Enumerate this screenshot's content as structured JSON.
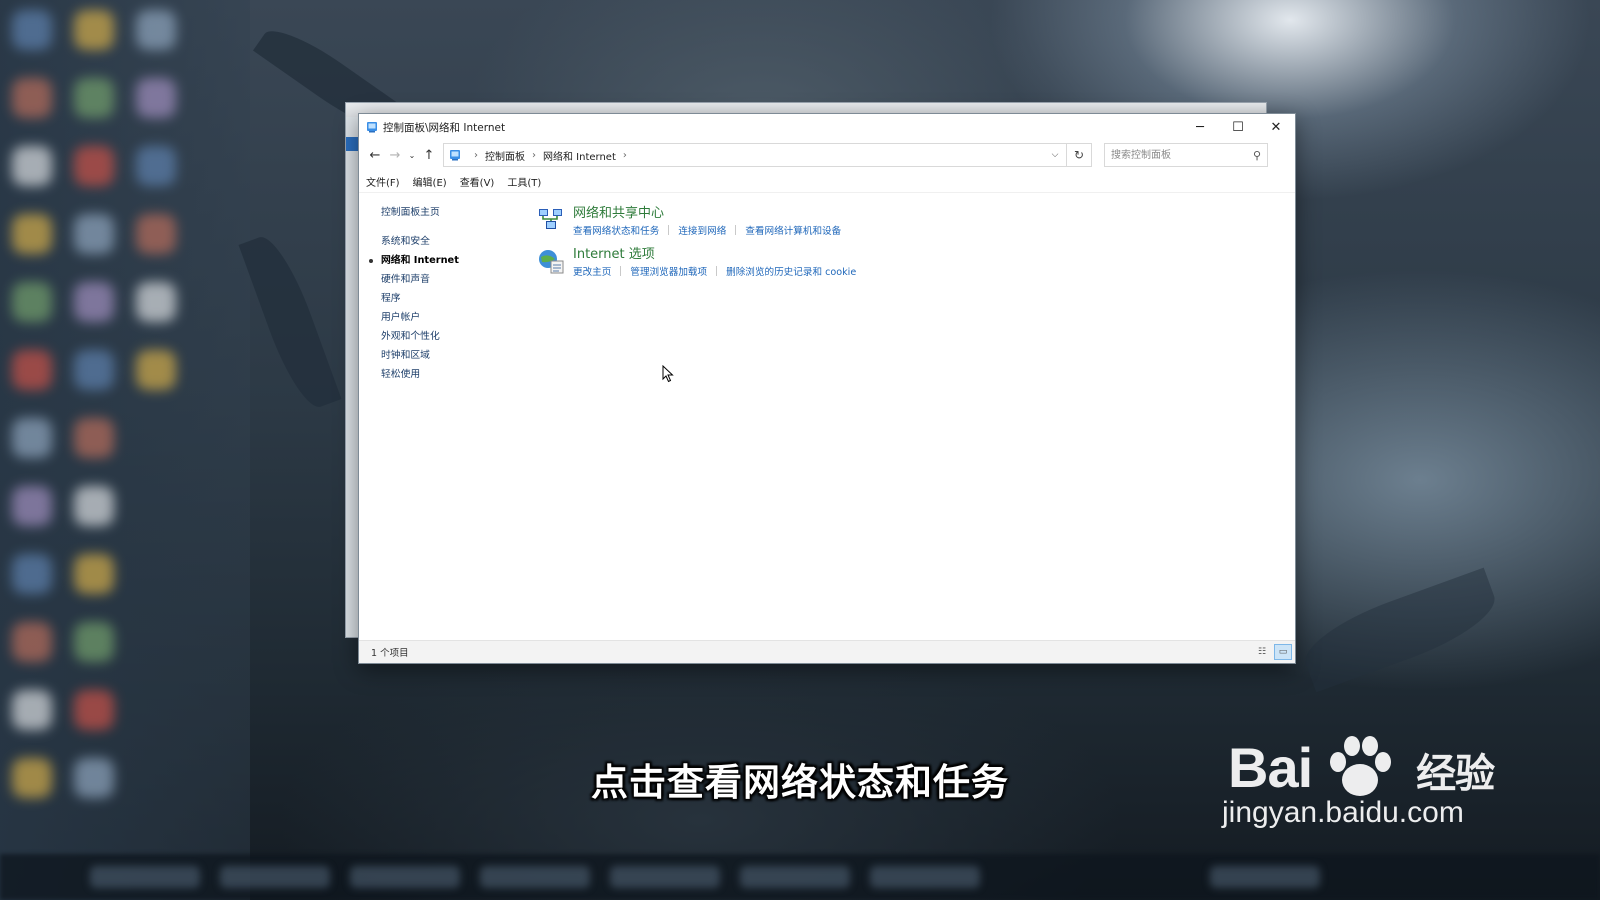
{
  "window": {
    "title": "控制面板\\网络和 Internet",
    "minimize": "─",
    "maximize": "☐",
    "close": "✕"
  },
  "address": {
    "crumbs": [
      "控制面板",
      "网络和 Internet"
    ],
    "search_placeholder": "搜索控制面板"
  },
  "menu": [
    "文件(F)",
    "编辑(E)",
    "查看(V)",
    "工具(T)"
  ],
  "sidebar": {
    "home": "控制面板主页",
    "items": [
      {
        "label": "系统和安全",
        "active": false
      },
      {
        "label": "网络和 Internet",
        "active": true
      },
      {
        "label": "硬件和声音",
        "active": false
      },
      {
        "label": "程序",
        "active": false
      },
      {
        "label": "用户帐户",
        "active": false
      },
      {
        "label": "外观和个性化",
        "active": false
      },
      {
        "label": "时钟和区域",
        "active": false
      },
      {
        "label": "轻松使用",
        "active": false
      }
    ]
  },
  "categories": [
    {
      "icon": "network-sharing-center-icon",
      "title": "网络和共享中心",
      "links": [
        "查看网络状态和任务",
        "连接到网络",
        "查看网络计算机和设备"
      ]
    },
    {
      "icon": "internet-options-icon",
      "title": "Internet 选项",
      "links": [
        "更改主页",
        "管理浏览器加载项",
        "删除浏览的历史记录和 cookie"
      ]
    }
  ],
  "status": {
    "count": "1 个项目"
  },
  "overlay": {
    "subtitle": "点击查看网络状态和任务",
    "watermark_brand": "Bai",
    "watermark_brand_tail": "经验",
    "watermark_url": "jingyan.baidu.com"
  },
  "colors": {
    "link": "#1f67ba",
    "category_title": "#2e7b3a",
    "sidebar_text": "#1e3f6a"
  }
}
